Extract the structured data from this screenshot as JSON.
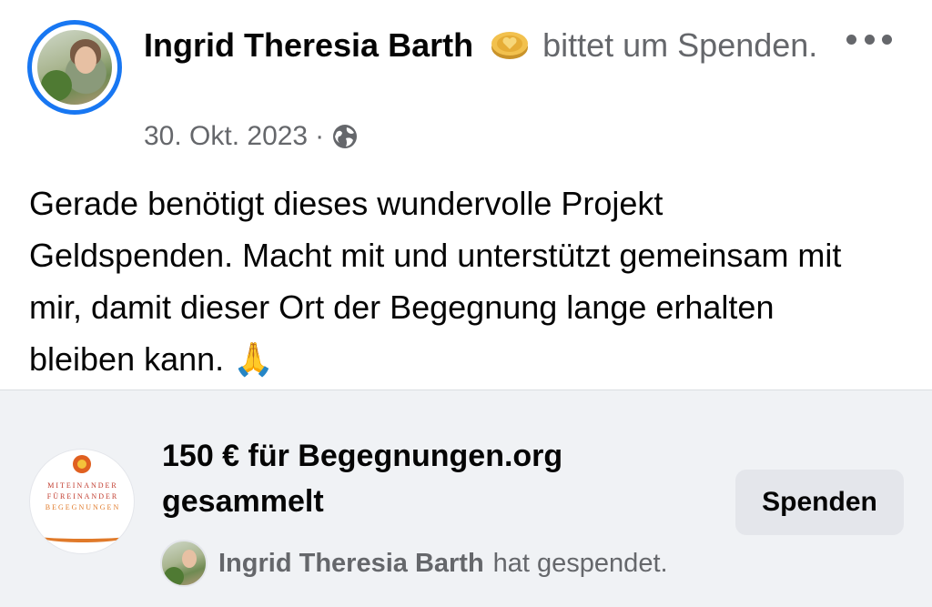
{
  "post": {
    "author": "Ingrid Theresia Barth",
    "action": "bittet um Spenden.",
    "date": "30. Okt. 2023",
    "separator": "·",
    "privacy_icon": "globe-icon",
    "text": "Gerade benötigt dieses wundervolle Projekt Geldspenden. Macht mit und unterstützt gemeinsam mit mir, damit dieser Ort der Begegnung lange erhalten bleiben kann.",
    "emoji": "🙏"
  },
  "fundraiser": {
    "logo_lines": [
      "MITEINANDER",
      "FÜREINANDER",
      "BEGEGNUNGEN"
    ],
    "title": "150 € für Begegnungen.org gesammelt",
    "button_label": "Spenden",
    "donor_name": "Ingrid Theresia Barth",
    "donor_action": "hat gespendet."
  },
  "colors": {
    "accent": "#1877f2",
    "secondary_text": "#65676b",
    "card_background": "#f0f2f5",
    "button_background": "#e4e6eb"
  }
}
